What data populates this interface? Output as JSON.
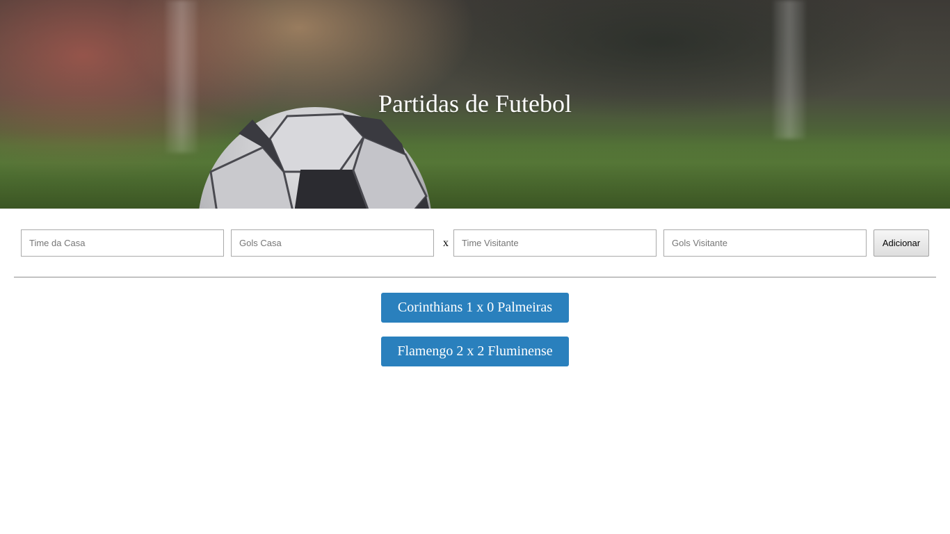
{
  "hero": {
    "title": "Partidas de Futebol"
  },
  "form": {
    "home_team_placeholder": "Time da Casa",
    "home_goals_placeholder": "Gols Casa",
    "separator": "x",
    "away_team_placeholder": "Time Visitante",
    "away_goals_placeholder": "Gols Visitante",
    "add_label": "Adicionar"
  },
  "matches": [
    {
      "label": "Corinthians 1 x 0 Palmeiras"
    },
    {
      "label": "Flamengo 2 x 2 Fluminense"
    }
  ],
  "colors": {
    "match_button": "#2a80bd",
    "title_text": "#ffffff"
  }
}
